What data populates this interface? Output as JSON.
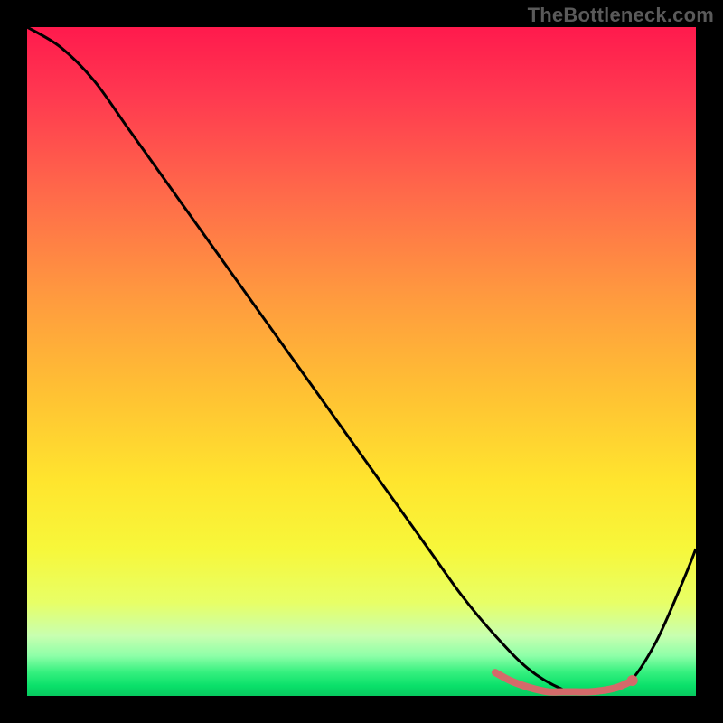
{
  "watermark": "TheBottleneck.com",
  "chart_data": {
    "type": "line",
    "title": "",
    "xlabel": "",
    "ylabel": "",
    "xlim": [
      0,
      100
    ],
    "ylim": [
      0,
      100
    ],
    "series": [
      {
        "name": "curve",
        "x": [
          0,
          5,
          10,
          15,
          20,
          25,
          30,
          35,
          40,
          45,
          50,
          55,
          60,
          65,
          70,
          75,
          80,
          83,
          86,
          90,
          94,
          98,
          100
        ],
        "values": [
          100,
          97,
          92,
          85,
          78,
          71,
          64,
          57,
          50,
          43,
          36,
          29,
          22,
          15,
          9,
          4,
          1,
          0.5,
          0.5,
          2,
          8,
          17,
          22
        ]
      },
      {
        "name": "highlight",
        "x": [
          70,
          72,
          74,
          76,
          78,
          80,
          82,
          84,
          86,
          88,
          89.5,
          90.5
        ],
        "values": [
          3.5,
          2.4,
          1.6,
          1.0,
          0.6,
          0.6,
          0.6,
          0.6,
          0.8,
          1.2,
          1.8,
          2.3
        ]
      }
    ],
    "gradient_stops": [
      {
        "offset": 0.0,
        "color": "#ff1a4d"
      },
      {
        "offset": 0.1,
        "color": "#ff3850"
      },
      {
        "offset": 0.25,
        "color": "#ff6a4a"
      },
      {
        "offset": 0.4,
        "color": "#ff993f"
      },
      {
        "offset": 0.55,
        "color": "#ffc233"
      },
      {
        "offset": 0.68,
        "color": "#ffe52e"
      },
      {
        "offset": 0.78,
        "color": "#f7f73a"
      },
      {
        "offset": 0.86,
        "color": "#e8ff66"
      },
      {
        "offset": 0.91,
        "color": "#c8ffb0"
      },
      {
        "offset": 0.94,
        "color": "#8effa8"
      },
      {
        "offset": 0.965,
        "color": "#34f07e"
      },
      {
        "offset": 0.985,
        "color": "#0ae06a"
      },
      {
        "offset": 1.0,
        "color": "#07c95f"
      }
    ],
    "colors": {
      "curve_stroke": "#000000",
      "highlight_stroke": "#d46a6a",
      "highlight_fill": "#d46a6a"
    }
  }
}
